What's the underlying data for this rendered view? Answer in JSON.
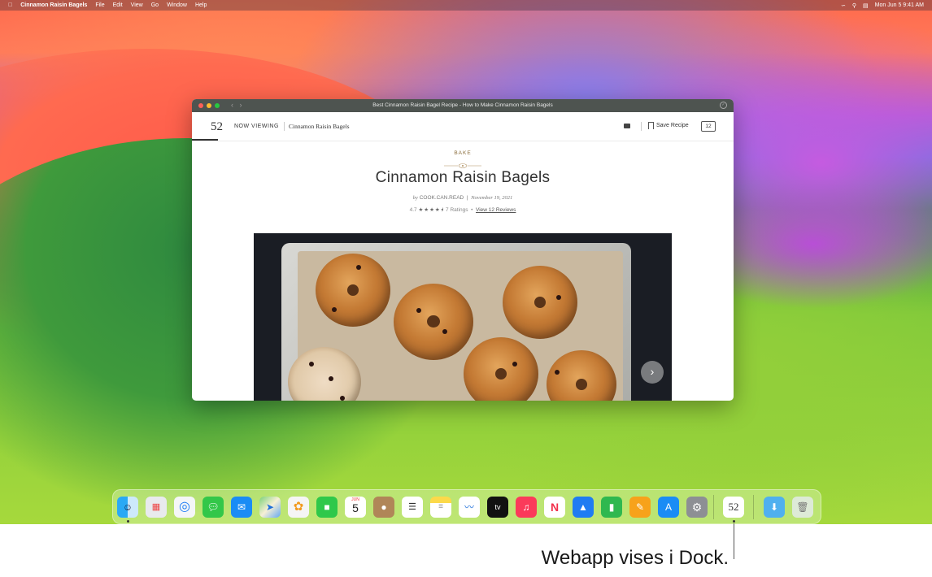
{
  "menubar": {
    "app_name": "Cinnamon Raisin Bagels",
    "menus": [
      "File",
      "Edit",
      "View",
      "Go",
      "Window",
      "Help"
    ],
    "clock": "Mon Jun 5  9:41 AM"
  },
  "window": {
    "title": "Best Cinnamon Raisin Bagel Recipe - How to Make Cinnamon Raisin Bagels",
    "site_logo": "52",
    "now_viewing_label": "NOW VIEWING",
    "breadcrumb": "Cinnamon Raisin Bagels",
    "save_label": "Save Recipe",
    "comment_count": "12"
  },
  "article": {
    "category": "BAKE",
    "title": "Cinnamon Raisin Bagels",
    "by": "by",
    "author": "COOK.CAN.READ",
    "date": "November 19, 2021",
    "rating_value": "4.7",
    "stars": "★★★★⯨",
    "ratings_count": "7 Ratings",
    "reviews_link": "View 12 Reviews"
  },
  "dock": {
    "calendar_month": "JUN",
    "calendar_day": "5",
    "webapp_label": "52",
    "icons": [
      "finder-icon",
      "launchpad-icon",
      "safari-icon",
      "messages-icon",
      "mail-icon",
      "maps-icon",
      "photos-icon",
      "facetime-icon",
      "calendar-icon",
      "contacts-icon",
      "reminders-icon",
      "notes-icon",
      "freeform-icon",
      "apple-tv-icon",
      "music-icon",
      "news-icon",
      "keynote-icon",
      "numbers-icon",
      "pages-icon",
      "app-store-icon",
      "system-settings-icon",
      "webapp-52-icon",
      "downloads-folder-icon",
      "trash-icon"
    ],
    "tv_label": "tv"
  },
  "callout": "Webapp vises i Dock.",
  "colors": {
    "titlebar": "#4e5450",
    "accent_gold": "#8a6d3b"
  }
}
